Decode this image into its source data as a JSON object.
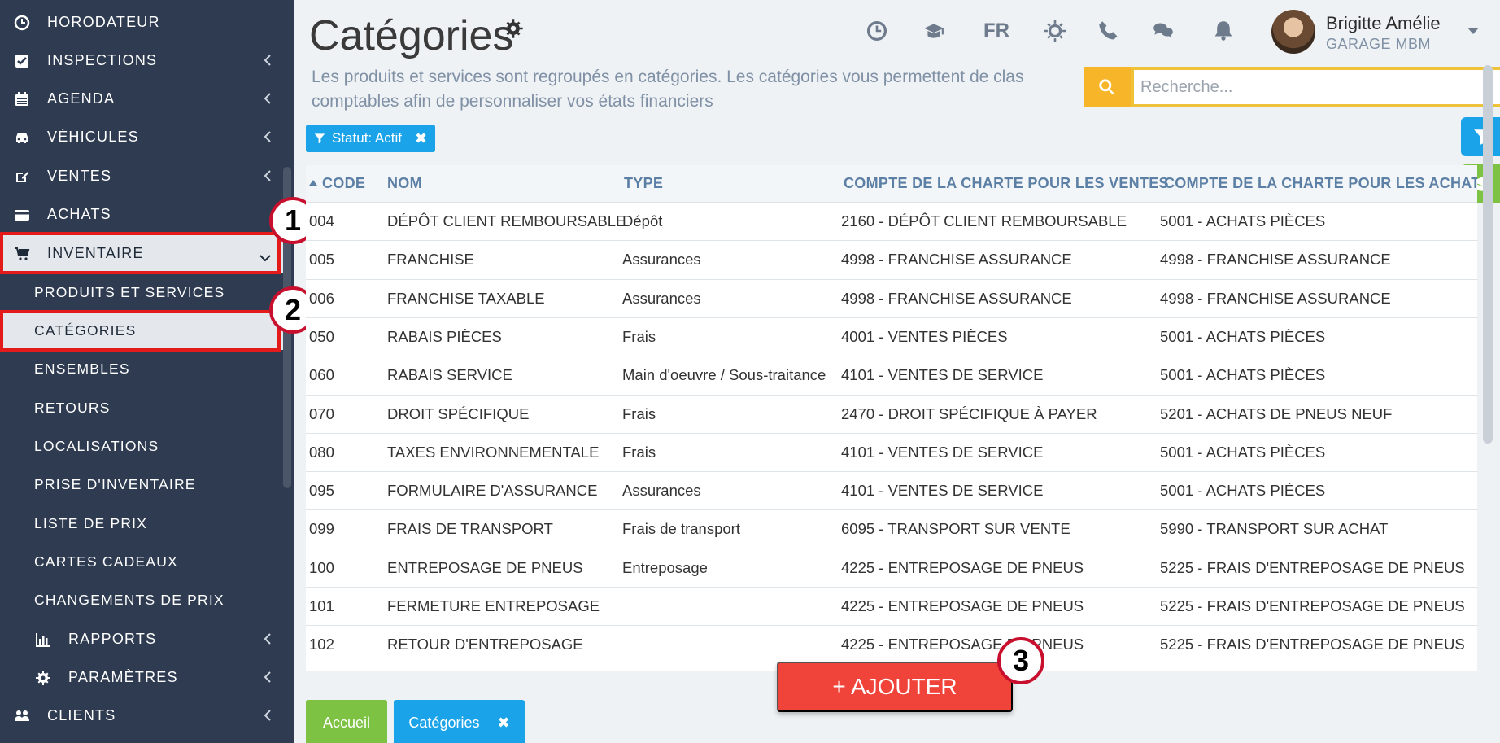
{
  "sidebar": {
    "items": [
      {
        "label": "HORODATEUR",
        "icon": "clock-icon"
      },
      {
        "label": "INSPECTIONS",
        "icon": "check-square-icon"
      },
      {
        "label": "AGENDA",
        "icon": "calendar-icon"
      },
      {
        "label": "VÉHICULES",
        "icon": "car-icon"
      },
      {
        "label": "VENTES",
        "icon": "edit-icon"
      },
      {
        "label": "ACHATS",
        "icon": "credit-card-icon"
      },
      {
        "label": "INVENTAIRE",
        "icon": "cart-icon"
      },
      {
        "label": "PRODUITS ET SERVICES"
      },
      {
        "label": "CATÉGORIES"
      },
      {
        "label": "ENSEMBLES"
      },
      {
        "label": "RETOURS"
      },
      {
        "label": "LOCALISATIONS"
      },
      {
        "label": "PRISE D'INVENTAIRE"
      },
      {
        "label": "LISTE DE PRIX"
      },
      {
        "label": "CARTES CADEAUX"
      },
      {
        "label": "CHANGEMENTS DE PRIX"
      },
      {
        "label": "RAPPORTS",
        "icon": "bar-chart-icon"
      },
      {
        "label": "PARAMÈTRES",
        "icon": "gear-icon"
      },
      {
        "label": "CLIENTS",
        "icon": "users-icon"
      }
    ]
  },
  "annotations": [
    "1",
    "2",
    "3"
  ],
  "header": {
    "title": "Catégories",
    "subtitle_line1": "Les produits et services sont regroupés en catégories. Les catégories vous permettent de clas",
    "subtitle_line2": "comptables afin de personnaliser vos états financiers",
    "lang": "FR",
    "user_name": "Brigitte Amélie",
    "user_org": "GARAGE MBM"
  },
  "search": {
    "placeholder": "Recherche..."
  },
  "filter": {
    "label": "Statut: Actif"
  },
  "table": {
    "columns": [
      "CODE",
      "NOM",
      "TYPE",
      "COMPTE DE LA CHARTE POUR LES VENTES",
      "COMPTE DE LA CHARTE POUR LES ACHAT"
    ],
    "rows": [
      [
        "004",
        "DÉPÔT CLIENT REMBOURSABLE",
        "Dépôt",
        "2160 - DÉPÔT CLIENT REMBOURSABLE",
        "5001 - ACHATS PIÈCES"
      ],
      [
        "005",
        "FRANCHISE",
        "Assurances",
        "4998 - FRANCHISE ASSURANCE",
        "4998 - FRANCHISE ASSURANCE"
      ],
      [
        "006",
        "FRANCHISE TAXABLE",
        "Assurances",
        "4998 - FRANCHISE ASSURANCE",
        "4998 - FRANCHISE ASSURANCE"
      ],
      [
        "050",
        "RABAIS PIÈCES",
        "Frais",
        "4001 - VENTES PIÈCES",
        "5001 - ACHATS PIÈCES"
      ],
      [
        "060",
        "RABAIS SERVICE",
        "Main d'oeuvre / Sous-traitance",
        "4101 - VENTES DE SERVICE",
        "5001 - ACHATS PIÈCES"
      ],
      [
        "070",
        "DROIT SPÉCIFIQUE",
        "Frais",
        "2470 - DROIT SPÉCIFIQUE À PAYER",
        "5201 - ACHATS DE PNEUS NEUF"
      ],
      [
        "080",
        "TAXES ENVIRONNEMENTALE",
        "Frais",
        "4101 - VENTES DE SERVICE",
        "5001 - ACHATS PIÈCES"
      ],
      [
        "095",
        "FORMULAIRE D'ASSURANCE",
        "Assurances",
        "4101 - VENTES DE SERVICE",
        "5001 - ACHATS PIÈCES"
      ],
      [
        "099",
        "FRAIS DE TRANSPORT",
        "Frais de transport",
        "6095 - TRANSPORT SUR VENTE",
        "5990 - TRANSPORT SUR ACHAT"
      ],
      [
        "100",
        "ENTREPOSAGE DE PNEUS",
        "Entreposage",
        "4225 - ENTREPOSAGE DE PNEUS",
        "5225 - FRAIS D'ENTREPOSAGE DE PNEUS"
      ],
      [
        "101",
        "FERMETURE ENTREPOSAGE",
        "",
        "4225 - ENTREPOSAGE DE PNEUS",
        "5225 - FRAIS D'ENTREPOSAGE DE PNEUS"
      ],
      [
        "102",
        "RETOUR D'ENTREPOSAGE",
        "",
        "4225 - ENTREPOSAGE DE PNEUS",
        "5225 - FRAIS D'ENTREPOSAGE DE PNEUS"
      ]
    ]
  },
  "footer": {
    "tab_home": "Accueil",
    "tab_categories": "Catégories",
    "add_label": "+ AJOUTER"
  },
  "colors": {
    "sidebar_bg": "#2e3b50",
    "accent_blue": "#1aa3e8",
    "accent_red": "#f0443a",
    "accent_green": "#7dc242",
    "search_yellow": "#f7b62a"
  }
}
